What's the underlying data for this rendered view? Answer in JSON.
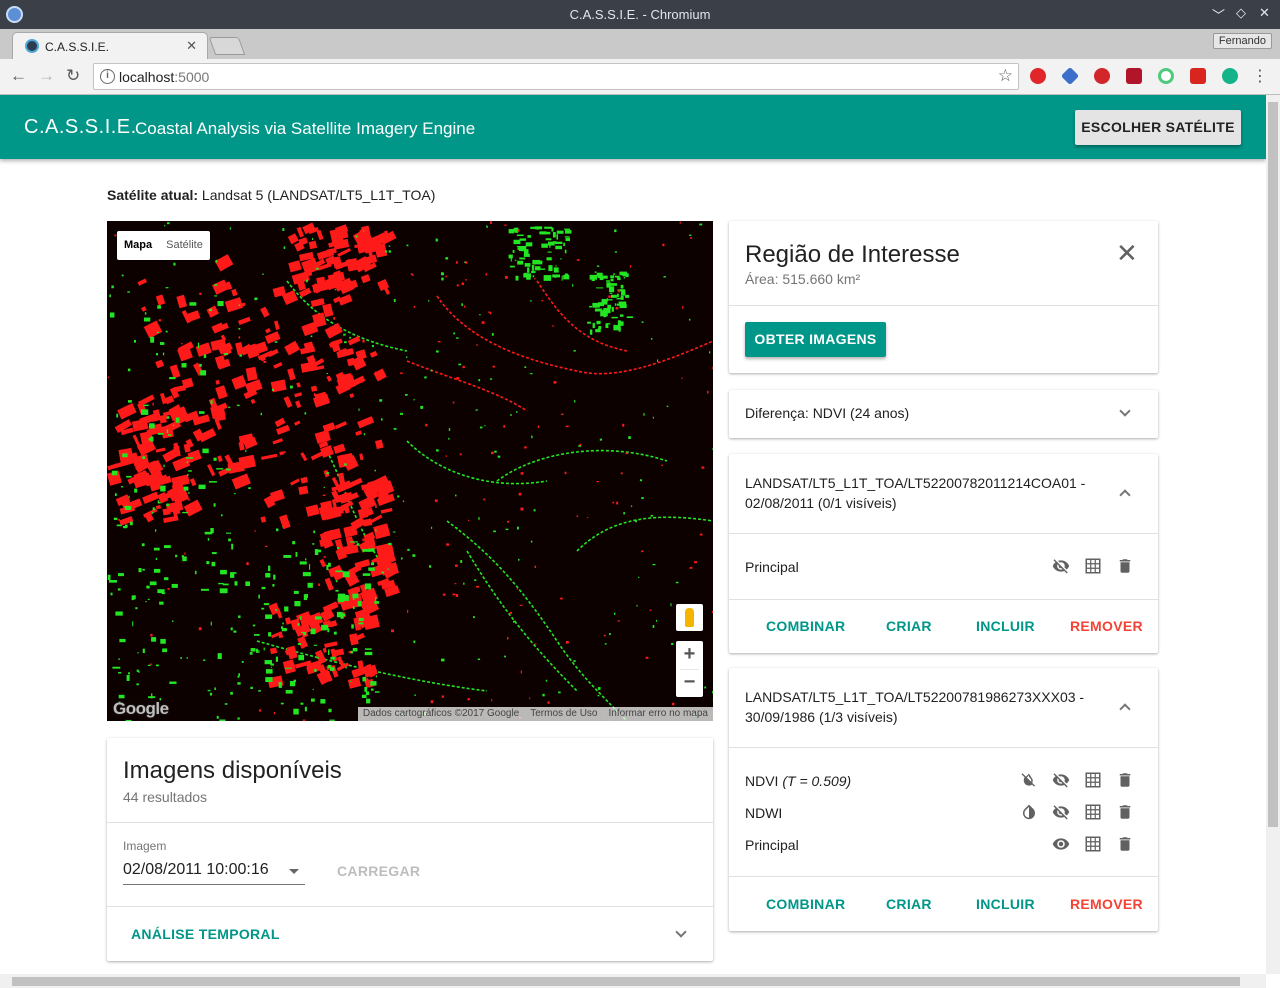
{
  "browser": {
    "window_title": "C.A.S.S.I.E. - Chromium",
    "tab_title": "C.A.S.S.I.E.",
    "url_host": "localhost",
    "url_port": ":5000",
    "profile_name": "Fernando"
  },
  "appbar": {
    "brand": "C.A.S.S.I.E.",
    "subtitle": "Coastal Analysis via Satellite Imagery Engine",
    "choose_satellite_label": "ESCOLHER SATÉLITE"
  },
  "current_satellite": {
    "label": "Satélite atual:",
    "value": "Landsat 5 (LANDSAT/LT5_L1T_TOA)"
  },
  "map": {
    "type_options": [
      "Mapa",
      "Satélite"
    ],
    "selected_type": "Mapa",
    "zoom_in": "+",
    "zoom_out": "−",
    "logo": "Google",
    "attribution": [
      "Dados cartográficos ©2017 Google",
      "Termos de Uso",
      "Informar erro no mapa"
    ],
    "colors": {
      "background": "#0d0100",
      "loss": "#ff1a1a",
      "gain": "#22e622"
    }
  },
  "available_images": {
    "title": "Imagens disponíveis",
    "count_text": "44 resultados",
    "field_label": "Imagem",
    "selected_image": "02/08/2011 10:00:16",
    "load_label": "CARREGAR",
    "temporal_label": "ANÁLISE TEMPORAL"
  },
  "region": {
    "title": "Região de Interesse",
    "area": "Área: 515.660 km²",
    "get_images_label": "OBTER IMAGENS"
  },
  "difference": {
    "label": "Diferença: NDVI (24 anos)"
  },
  "image_cards": [
    {
      "title": "LANDSAT/LT5_L1T_TOA/LT52200782011214COA01 - 02/08/2011 (0/1 visíveis)",
      "layers": [
        {
          "name": "Principal",
          "icons": [
            "visibility-off-icon",
            "grid-icon",
            "delete-icon"
          ]
        }
      ]
    },
    {
      "title": "LANDSAT/LT5_L1T_TOA/LT52200781986273XXX03 - 30/09/1986 (1/3 visíveis)",
      "layers": [
        {
          "name": "NDVI",
          "note": "(T = 0.509)",
          "icons": [
            "invert-colors-off-icon",
            "visibility-off-icon",
            "grid-icon",
            "delete-icon"
          ]
        },
        {
          "name": "NDWI",
          "icons": [
            "invert-colors-icon",
            "visibility-off-icon",
            "grid-icon",
            "delete-icon"
          ]
        },
        {
          "name": "Principal",
          "icons": [
            "visibility-icon",
            "grid-icon",
            "delete-icon"
          ]
        }
      ]
    }
  ],
  "card_actions": {
    "combine": "COMBINAR",
    "create": "CRIAR",
    "include": "INCLUIR",
    "remove": "REMOVER"
  },
  "theme": {
    "primary": "#009688",
    "danger": "#f44336"
  }
}
